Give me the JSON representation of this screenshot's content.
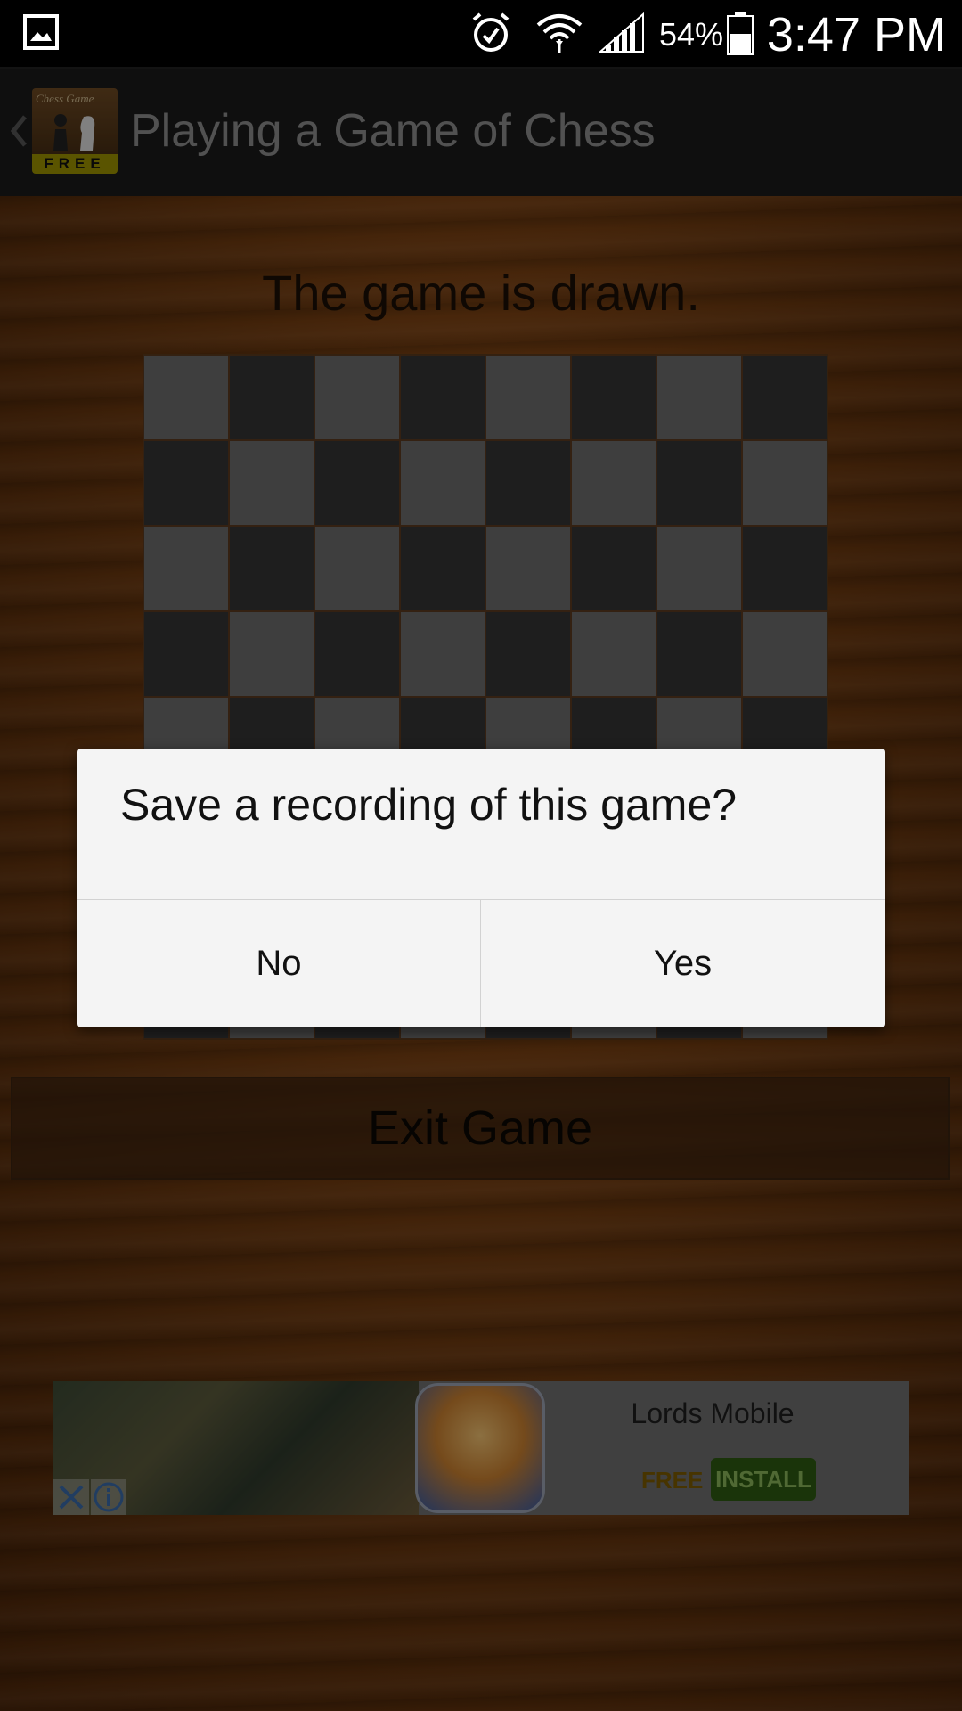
{
  "status_bar": {
    "battery_percent": "54%",
    "time": "3:47 PM"
  },
  "app_bar": {
    "logo_text": "Chess Game",
    "logo_badge": "FREE",
    "title": "Playing a Game of Chess"
  },
  "game": {
    "result": "The game is drawn.",
    "exit_label": "Exit Game"
  },
  "dialog": {
    "message": "Save a recording of this game?",
    "no_label": "No",
    "yes_label": "Yes"
  },
  "ad": {
    "app_name": "Lords Mobile",
    "price": "FREE",
    "install_label": "INSTALL"
  },
  "colors": {
    "board_light": "#6b6b6b",
    "board_dark": "#353535",
    "dialog_bg": "#f4f4f4",
    "wood": "#6e3a10"
  }
}
